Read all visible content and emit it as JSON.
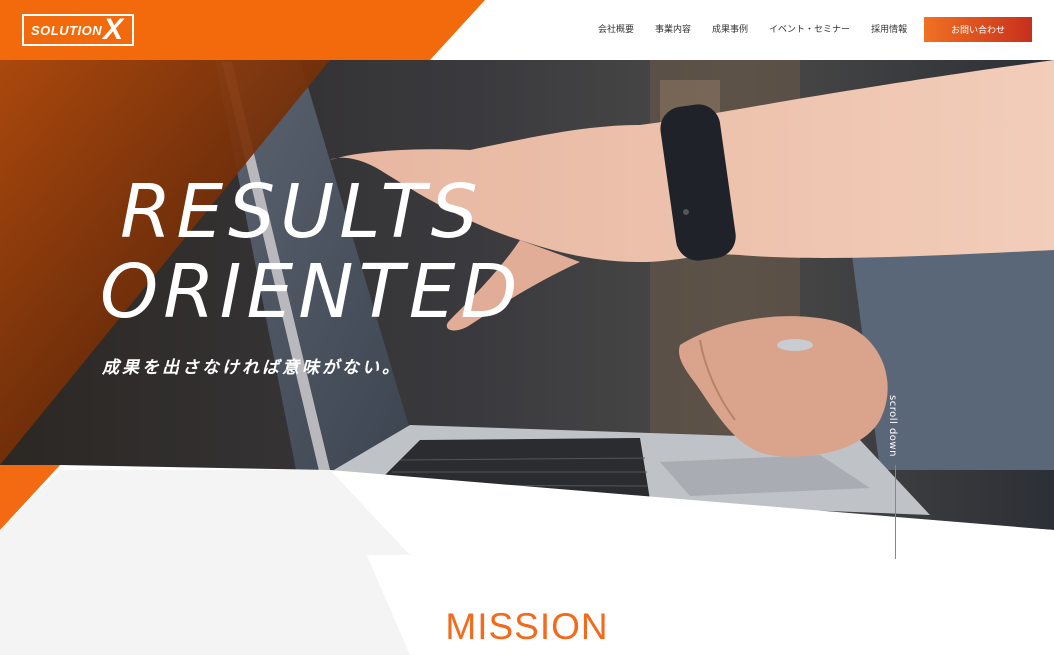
{
  "header": {
    "logo": {
      "word": "SOLUTION",
      "mark": "X"
    },
    "nav": [
      {
        "label": "会社概要"
      },
      {
        "label": "事業内容"
      },
      {
        "label": "成果事例"
      },
      {
        "label": "イベント・セミナー"
      },
      {
        "label": "採用情報"
      }
    ],
    "contact_label": "お問い合わせ"
  },
  "hero": {
    "headline_line1": "RESULTS",
    "headline_line2": "ORIENTED",
    "tagline": "成果を出さなければ意味がない。",
    "scroll_label": "scroll down"
  },
  "section": {
    "title": "MISSION"
  },
  "colors": {
    "accent": "#f26a1b",
    "accent_dark": "#c7301c",
    "bg_grey": "#f4f4f4"
  }
}
